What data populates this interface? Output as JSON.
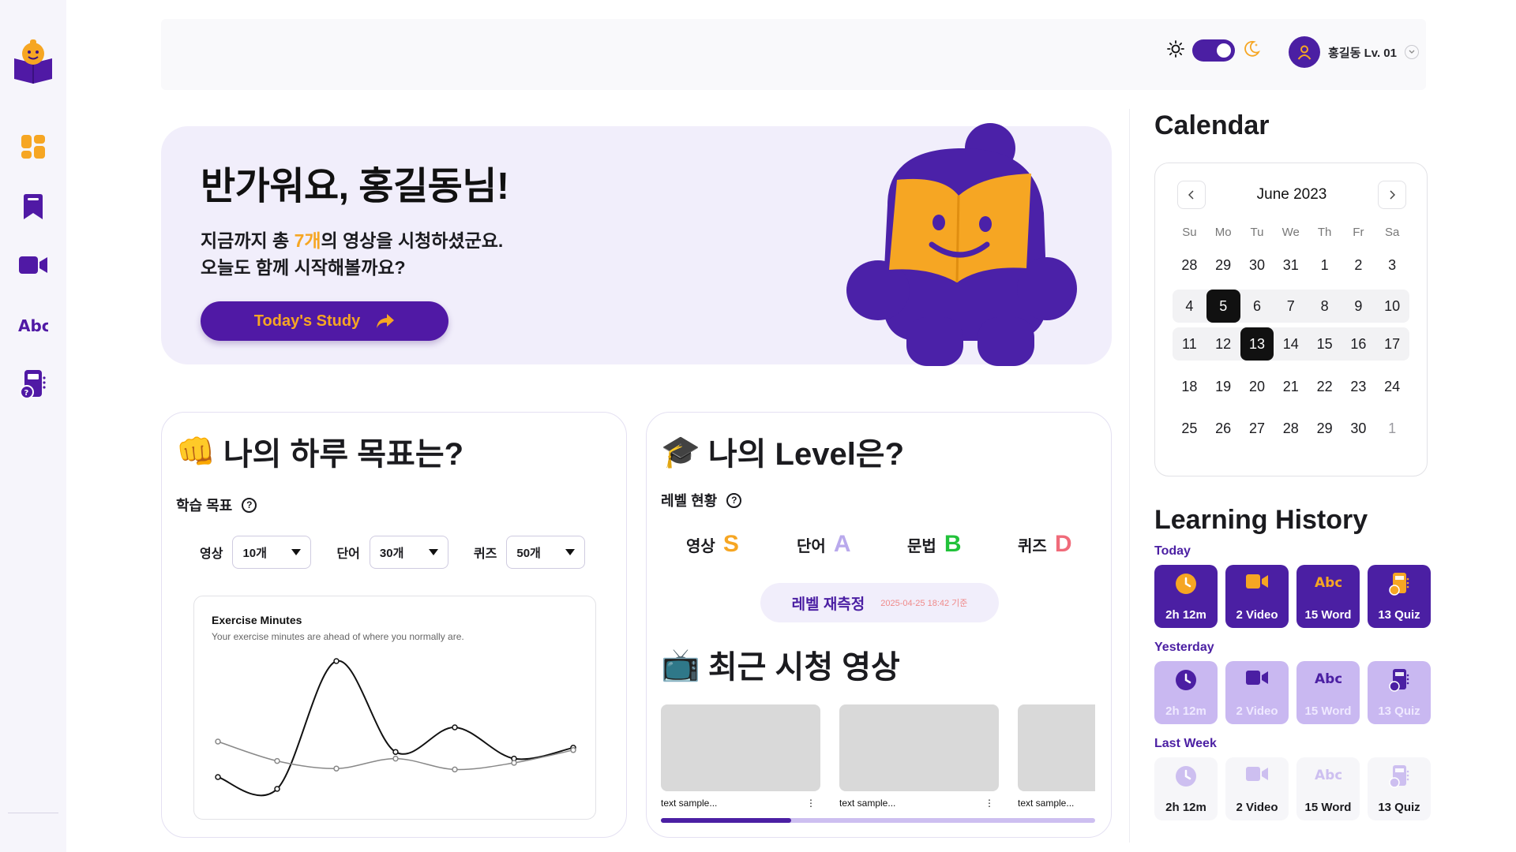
{
  "header": {
    "profile_name": "홍길동 Lv. 01"
  },
  "hero": {
    "title": "반가워요, 홍길동님!",
    "sub_line1_prefix": "지금까지 총 ",
    "sub_line1_accent": "7개",
    "sub_line1_suffix": "의 영상을 시청하셨군요.",
    "sub_line2": "오늘도 함께 시작해볼까요?",
    "button_label": "Today's Study"
  },
  "goal_card": {
    "title": "나의 하루 목표는?",
    "emoji": "👊",
    "section_label": "학습 목표",
    "goals": [
      {
        "label": "영상",
        "value": "10개"
      },
      {
        "label": "단어",
        "value": "30개"
      },
      {
        "label": "퀴즈",
        "value": "50개"
      }
    ]
  },
  "chart_data": {
    "type": "line",
    "title": "Exercise Minutes",
    "subtitle": "Your exercise minutes are ahead of where you normally are.",
    "x": [
      1,
      2,
      3,
      4,
      5,
      6,
      7
    ],
    "series": [
      {
        "values": [
          35,
          10,
          280,
          88,
          140,
          74,
          97
        ],
        "color": "#111111"
      },
      {
        "values": [
          110,
          69,
          53,
          74,
          51,
          65,
          92
        ],
        "color": "#888888"
      }
    ],
    "ylim": [
      0,
      300
    ],
    "grid": false
  },
  "level_card": {
    "title": "나의 Level은?",
    "emoji": "🎓",
    "section_label": "레벨 현황",
    "levels": [
      {
        "label": "영상",
        "grade": "S",
        "color": "#f6a623"
      },
      {
        "label": "단어",
        "grade": "A",
        "color": "#b9a9ec"
      },
      {
        "label": "문법",
        "grade": "B",
        "color": "#22c23a"
      },
      {
        "label": "퀴즈",
        "grade": "D",
        "color": "#f06b7a"
      }
    ],
    "remeasure_label": "레벨 재측정",
    "remeasure_date": "2025-04-25 18:42 기준",
    "recent_title": "최근 시청 영상",
    "recent_emoji": "📺",
    "videos": [
      {
        "caption": "text sample..."
      },
      {
        "caption": "text sample..."
      },
      {
        "caption": "text sample..."
      }
    ],
    "progress": 0.3
  },
  "calendar": {
    "title": "Calendar",
    "month": "June 2023",
    "dow": [
      "Su",
      "Mo",
      "Tu",
      "We",
      "Th",
      "Fr",
      "Sa"
    ],
    "weeks": [
      [
        "28",
        "29",
        "30",
        "31",
        "1",
        "2",
        "3"
      ],
      [
        "4",
        "5",
        "6",
        "7",
        "8",
        "9",
        "10"
      ],
      [
        "11",
        "12",
        "13",
        "14",
        "15",
        "16",
        "17"
      ],
      [
        "18",
        "19",
        "20",
        "21",
        "22",
        "23",
        "24"
      ],
      [
        "25",
        "26",
        "27",
        "28",
        "29",
        "30",
        "1"
      ]
    ],
    "selected": [
      "5",
      "13"
    ]
  },
  "history": {
    "title": "Learning History",
    "groups": [
      {
        "label": "Today",
        "items": [
          "2h 12m",
          "2 Video",
          "15 Word",
          "13 Quiz"
        ]
      },
      {
        "label": "Yesterday",
        "items": [
          "2h 12m",
          "2 Video",
          "15 Word",
          "13 Quiz"
        ]
      },
      {
        "label": "Last Week",
        "items": [
          "2h 12m",
          "2 Video",
          "15 Word",
          "13 Quiz"
        ]
      }
    ]
  },
  "colors": {
    "brand": "#4b1fa3",
    "accent": "#f6a623",
    "hero_bg": "#f1eefb"
  },
  "icons": {
    "sidebar": [
      "dashboard-icon",
      "bookmark-icon",
      "video-icon",
      "abc-icon",
      "quiz-icon"
    ],
    "history": [
      "clock-icon",
      "video-icon",
      "abc-icon",
      "quiz-icon"
    ]
  }
}
